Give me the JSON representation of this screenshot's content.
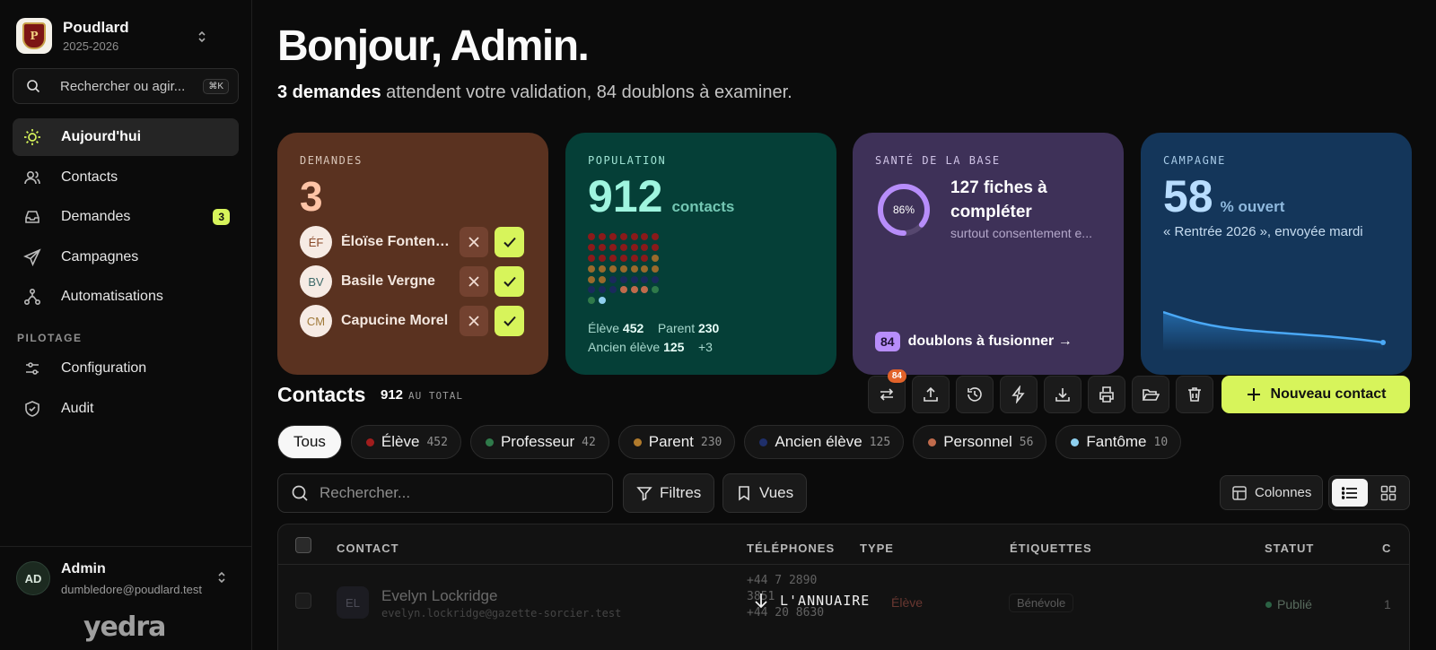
{
  "sidebar": {
    "brand": {
      "name": "Poudlard",
      "year": "2025-2026",
      "crest_letter": "P"
    },
    "search": {
      "label": "Rechercher ou agir...",
      "shortcut": "⌘K"
    },
    "items": [
      {
        "label": "Aujourd'hui",
        "icon": "sun-icon",
        "active": true
      },
      {
        "label": "Contacts",
        "icon": "users-icon"
      },
      {
        "label": "Demandes",
        "icon": "inbox-icon",
        "badge": "3"
      },
      {
        "label": "Campagnes",
        "icon": "send-icon"
      },
      {
        "label": "Automatisations",
        "icon": "workflow-icon"
      }
    ],
    "section_label": "PILOTAGE",
    "section_items": [
      {
        "label": "Configuration",
        "icon": "sliders-icon"
      },
      {
        "label": "Audit",
        "icon": "shield-icon"
      }
    ],
    "user": {
      "initials": "AD",
      "name": "Admin",
      "email": "dumbledore@poudlard.test"
    },
    "logo_text": "yedra"
  },
  "header": {
    "greeting": "Bonjour, Admin.",
    "sub_bold": "3 demandes",
    "sub_rest": " attendent votre validation, 84 doublons à examiner."
  },
  "cards": {
    "demandes": {
      "eyebrow": "DEMANDES",
      "count": "3",
      "requests": [
        {
          "initials": "ÉF",
          "name": "Éloïse Fontenelle"
        },
        {
          "initials": "BV",
          "name": "Basile Vergne"
        },
        {
          "initials": "CM",
          "name": "Capucine Morel"
        }
      ]
    },
    "population": {
      "eyebrow": "POPULATION",
      "count": "912",
      "unit": "contacts",
      "stats": [
        {
          "label": "Élève",
          "value": "452"
        },
        {
          "label": "Parent",
          "value": "230"
        },
        {
          "label": "Ancien élève",
          "value": "125"
        },
        {
          "label": "",
          "value": "+3"
        }
      ],
      "dot_colors": [
        "#8b1a1a",
        "#8b1a1a",
        "#8b1a1a",
        "#8b1a1a",
        "#8b1a1a",
        "#8b1a1a",
        "#8b1a1a",
        "#8b1a1a",
        "#8b1a1a",
        "#8b1a1a",
        "#8b1a1a",
        "#8b1a1a",
        "#8b1a1a",
        "#8b1a1a",
        "#8b1a1a",
        "#8b1a1a",
        "#8b1a1a",
        "#8b1a1a",
        "#8b1a1a",
        "#8b1a1a",
        "#9a6a2c",
        "#9a6a2c",
        "#9a6a2c",
        "#9a6a2c",
        "#9a6a2c",
        "#9a6a2c",
        "#9a6a2c",
        "#9a6a2c",
        "#9a6a2c",
        "#9a6a2c",
        "#1a2a5c",
        "#1a2a5c",
        "#1a2a5c",
        "#1a2a5c",
        "#1a2a5c",
        "#1a2a5c",
        "#1a2a5c",
        "#1a2a5c",
        "#c06b4c",
        "#c06b4c",
        "#c06b4c",
        "#2f7a4a",
        "#2f7a4a",
        "#8fd0ef"
      ]
    },
    "sante": {
      "eyebrow": "SANTÉ DE LA BASE",
      "percent_label": "86%",
      "percent": 0.86,
      "title": "127 fiches à compléter",
      "sub": "surtout consentement e...",
      "dup_count": "84",
      "dup_label": "doublons à fusionner →"
    },
    "campagne": {
      "eyebrow": "CAMPAGNE",
      "value": "58",
      "unit": "% ouvert",
      "sub": "« Rentrée 2026 », envoyée mardi"
    }
  },
  "contacts": {
    "title": "Contacts",
    "total": "912",
    "total_suffix": "AU TOTAL",
    "toolbar": [
      {
        "icon": "merge-icon",
        "count": "84"
      },
      {
        "icon": "upload-icon"
      },
      {
        "icon": "history-icon"
      },
      {
        "icon": "bolt-icon"
      },
      {
        "icon": "download-icon"
      },
      {
        "icon": "print-icon"
      },
      {
        "icon": "folder-icon"
      },
      {
        "icon": "trash-icon"
      }
    ],
    "new_button": "Nouveau contact",
    "chips": [
      {
        "label": "Tous",
        "active": true
      },
      {
        "label": "Élève",
        "count": "452",
        "color": "#a11d1d"
      },
      {
        "label": "Professeur",
        "count": "42",
        "color": "#2f7a4a"
      },
      {
        "label": "Parent",
        "count": "230",
        "color": "#b07a2c"
      },
      {
        "label": "Ancien élève",
        "count": "125",
        "color": "#1f2f6a"
      },
      {
        "label": "Personnel",
        "count": "56",
        "color": "#c06b4c"
      },
      {
        "label": "Fantôme",
        "count": "10",
        "color": "#8fd0ef"
      }
    ],
    "search_placeholder": "Rechercher...",
    "filters_label": "Filtres",
    "views_label": "Vues",
    "columns_label": "Colonnes",
    "table": {
      "headers": {
        "contact": "CONTACT",
        "phones": "TÉLÉPHONES",
        "type": "TYPE",
        "tags": "ÉTIQUETTES",
        "status": "STATUT",
        "extra": "C"
      },
      "row": {
        "initials": "EL",
        "name": "Evelyn Lockridge",
        "email": "evelyn.lockridge@gazette-sorcier.test",
        "phone1": "+44 7 2890",
        "phone2": "3851",
        "phone3": "+44 20 8630",
        "type": "Élève",
        "tag": "Bénévole",
        "status": "Publié",
        "extra": "1"
      }
    },
    "overlay_label": "L'ANNUAIRE"
  }
}
